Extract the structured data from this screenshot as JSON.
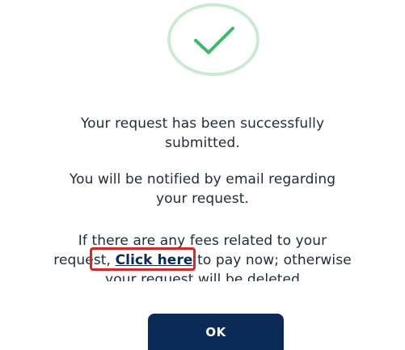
{
  "success_icon": {
    "icon": "checkmark-icon",
    "ring_color": "#c8eccf",
    "check_color": "#3fb968"
  },
  "message": {
    "line1": "Your request has been successfully",
    "line2": "submitted.",
    "line3": "You will be notified by email regarding",
    "line4": "your request.",
    "line5": "If there are any fees related to your",
    "line6_prefix": "request, ",
    "link_text": "Click here",
    "line6_suffix": " to pay now; otherwise",
    "line7": "your request will be deleted"
  },
  "actions": {
    "ok_label": "OK"
  },
  "colors": {
    "button": "#0b2a55",
    "highlight": "#e02424",
    "link": "#0a2a5e"
  }
}
